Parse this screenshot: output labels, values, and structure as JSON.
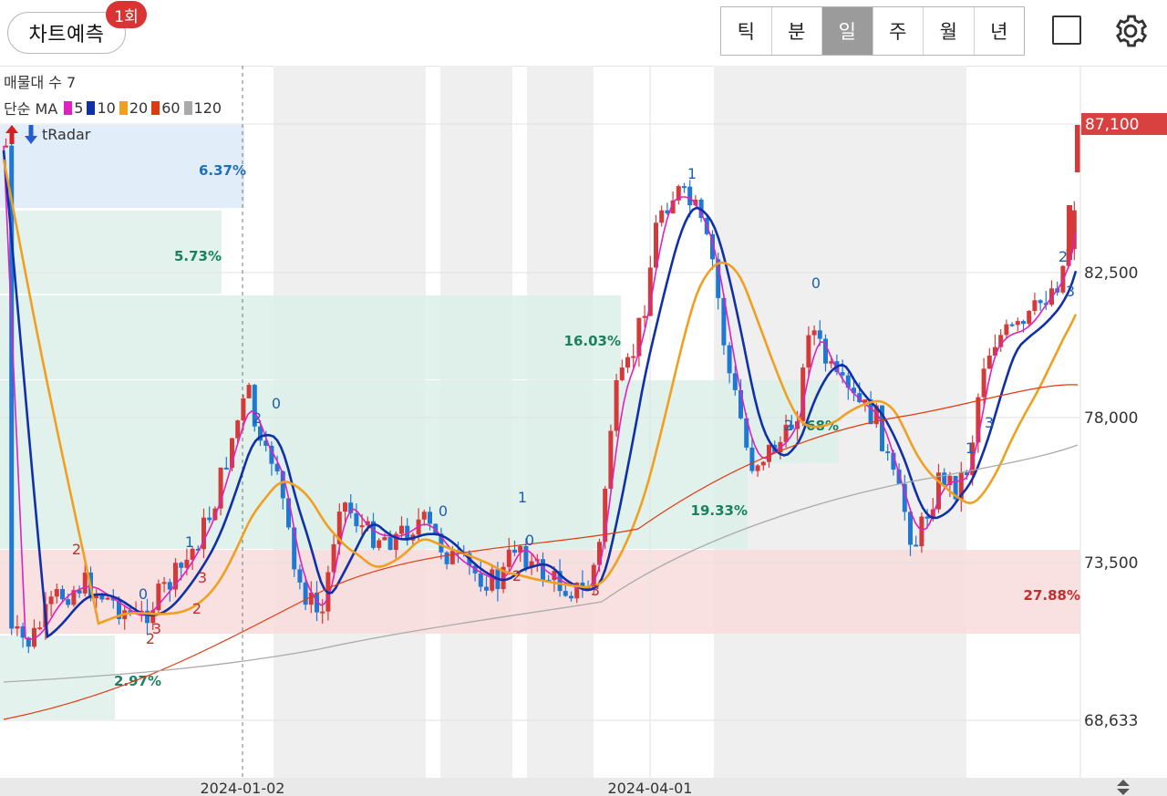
{
  "header": {
    "predict_label": "차트예측",
    "badge_label": "1회",
    "period_tabs": [
      "틱",
      "분",
      "일",
      "주",
      "월",
      "년"
    ],
    "active_period": "일",
    "square_icon": "fullscreen-square-icon",
    "settings_icon": "gear-icon"
  },
  "legend": {
    "volume_profile": "매물대 수 7",
    "ma_title": "단순 MA",
    "ma_items": [
      {
        "label": "5",
        "color": "#e020c0"
      },
      {
        "label": "10",
        "color": "#1030a8"
      },
      {
        "label": "20",
        "color": "#f0a020"
      },
      {
        "label": "60",
        "color": "#e03a10"
      },
      {
        "label": "120",
        "color": "#aaaaaa"
      }
    ],
    "tradar_label": "tRadar"
  },
  "chart_data": {
    "type": "candlestick",
    "y_ticks": [
      "87,100",
      "82,500",
      "78,000",
      "73,500",
      "68,633"
    ],
    "current_price": "87,100",
    "x_ticks": [
      "2024-01-02",
      "2024-04-01"
    ],
    "zones": [
      {
        "label": "6.37%",
        "color": "#1e6fc0"
      },
      {
        "label": "5.73%",
        "color": "#1a8060"
      },
      {
        "label": "16.03%",
        "color": "#1a8060"
      },
      {
        "label": "19.33%",
        "color": "#1a8060"
      },
      {
        "label": "68%",
        "color": "#1a8060"
      },
      {
        "label": "27.88%",
        "color": "#c03030"
      },
      {
        "label": "2.97%",
        "color": "#1a8060"
      }
    ],
    "markers": [
      "2",
      "0",
      "2",
      "1",
      "3",
      "2",
      "2",
      "0",
      "3",
      "0",
      "2",
      "1",
      "3",
      "0",
      "2",
      "0",
      "1",
      "1",
      "3",
      "2",
      "3"
    ],
    "colors": {
      "up": "#d43a3a",
      "down": "#1f78d4",
      "ma5": "#e020c0",
      "ma10": "#1030a8",
      "ma20": "#f0a020",
      "ma60": "#e03a10",
      "ma120": "#aaaaaa"
    }
  }
}
